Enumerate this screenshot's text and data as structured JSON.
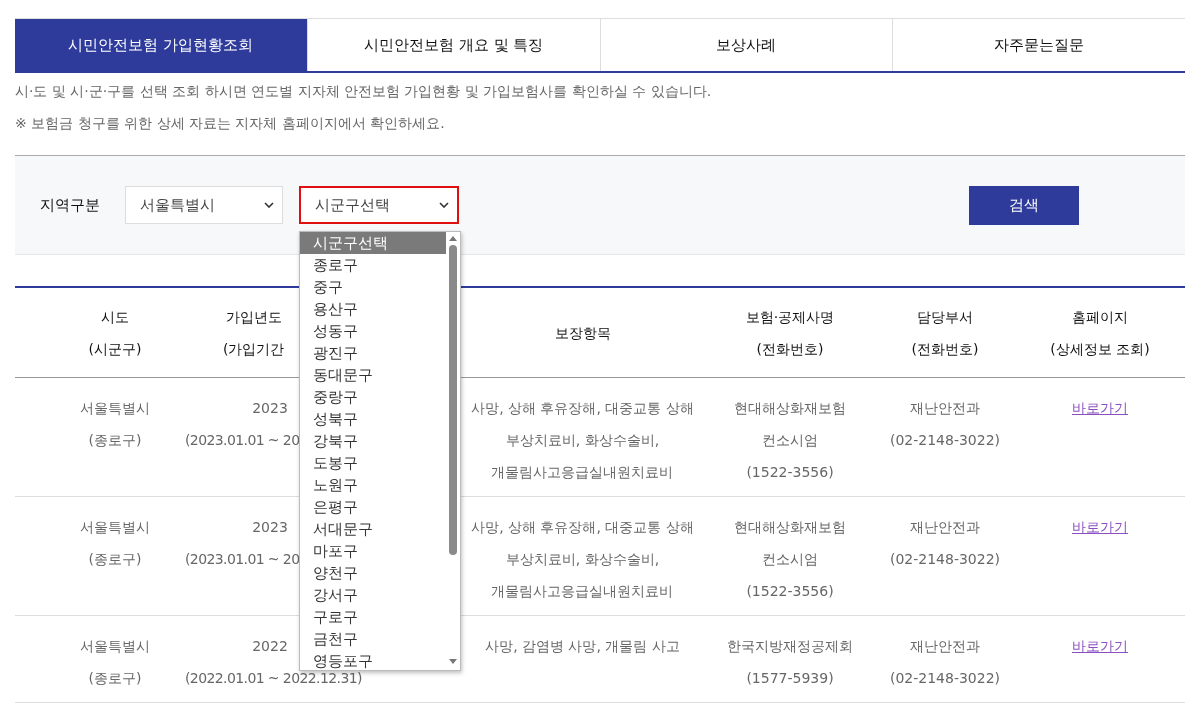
{
  "tabs": [
    {
      "label": "시민안전보험 가입현황조회",
      "selected": true
    },
    {
      "label": "시민안전보험 개요 및 특징",
      "selected": false
    },
    {
      "label": "보상사례",
      "selected": false
    },
    {
      "label": "자주묻는질문",
      "selected": false
    }
  ],
  "notes": [
    "시·도 및 시·군·구를 선택 조회 하시면 연도별 지자체 안전보험 가입현황 및 가입보험사를 확인하실 수 있습니다.",
    "※ 보험금 청구를 위한 상세 자료는 지자체 홈페이지에서 확인하세요."
  ],
  "filter": {
    "label": "지역구분",
    "region_select": {
      "value": "서울특별시"
    },
    "district_select": {
      "value": "시군구선택",
      "focused": true,
      "open": true,
      "options": [
        {
          "label": "시군구선택",
          "selected": true
        },
        {
          "label": "종로구",
          "selected": false
        },
        {
          "label": "중구",
          "selected": false
        },
        {
          "label": "용산구",
          "selected": false
        },
        {
          "label": "성동구",
          "selected": false
        },
        {
          "label": "광진구",
          "selected": false
        },
        {
          "label": "동대문구",
          "selected": false
        },
        {
          "label": "중랑구",
          "selected": false
        },
        {
          "label": "성북구",
          "selected": false
        },
        {
          "label": "강북구",
          "selected": false
        },
        {
          "label": "도봉구",
          "selected": false
        },
        {
          "label": "노원구",
          "selected": false
        },
        {
          "label": "은평구",
          "selected": false
        },
        {
          "label": "서대문구",
          "selected": false
        },
        {
          "label": "마포구",
          "selected": false
        },
        {
          "label": "양천구",
          "selected": false
        },
        {
          "label": "강서구",
          "selected": false
        },
        {
          "label": "구로구",
          "selected": false
        },
        {
          "label": "금천구",
          "selected": false
        },
        {
          "label": "영등포구",
          "selected": false
        }
      ]
    },
    "search_button": "검색"
  },
  "table": {
    "columns": [
      {
        "lines": [
          "시도",
          "(시군구)"
        ]
      },
      {
        "lines": [
          "가입년도",
          "(가입기간"
        ]
      },
      {
        "lines": [
          "보장항목"
        ]
      },
      {
        "lines": [
          "보험·공제사명",
          "(전화번호)"
        ]
      },
      {
        "lines": [
          "담당부서",
          "(전화번호)"
        ]
      },
      {
        "lines": [
          "홈페이지",
          "(상세정보 조회)"
        ]
      }
    ],
    "rows": [
      {
        "region": [
          "서울특별시",
          "(종로구)"
        ],
        "year": "2023",
        "period": "(2023.01.01 ~ 20",
        "coverage": [
          "사망, 상해 후유장해, 대중교통 상해",
          "부상치료비, 화상수술비,",
          "개물림사고응급실내원치료비"
        ],
        "insurer": [
          "현대해상화재보험",
          "컨소시엄",
          "(1522-3556)"
        ],
        "department": [
          "재난안전과",
          "(02-2148-3022)"
        ],
        "link": "바로가기"
      },
      {
        "region": [
          "서울특별시",
          "(종로구)"
        ],
        "year": "2023",
        "period": "(2023.01.01 ~ 20",
        "coverage": [
          "사망, 상해 후유장해, 대중교통 상해",
          "부상치료비, 화상수술비,",
          "개물림사고응급실내원치료비"
        ],
        "insurer": [
          "현대해상화재보험",
          "컨소시엄",
          "(1522-3556)"
        ],
        "department": [
          "재난안전과",
          "(02-2148-3022)"
        ],
        "link": "바로가기"
      },
      {
        "region": [
          "서울특별시",
          "(종로구)"
        ],
        "year": "2022",
        "period": "(2022.01.01 ~ 2022.12.31)",
        "coverage": [
          "사망, 감염병 사망, 개물림 사고"
        ],
        "insurer": [
          "한국지방재정공제회",
          "(1577-5939)"
        ],
        "department": [
          "재난안전과",
          "(02-2148-3022)"
        ],
        "link": "바로가기"
      }
    ]
  }
}
